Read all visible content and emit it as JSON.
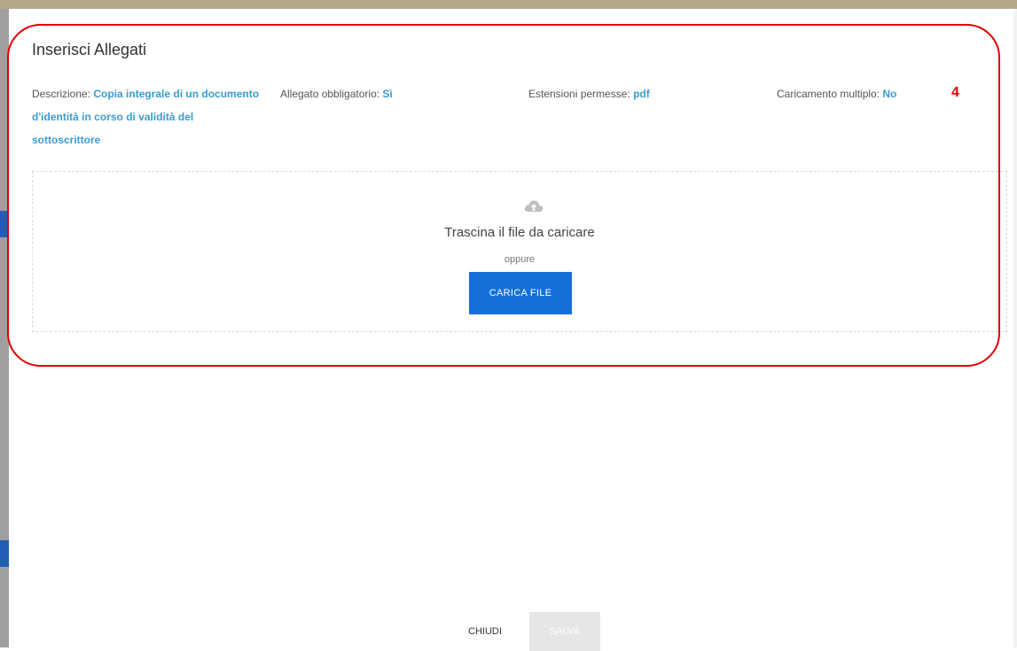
{
  "modal": {
    "title": "Inserisci Allegati",
    "descrizione_label": "Descrizione:",
    "descrizione_value": "Copia integrale di un documento d'identità in corso di validità del sottoscrittore",
    "obbligatorio_label": "Allegato obbligatorio:",
    "obbligatorio_value": "Sì",
    "estensioni_label": "Estensioni permesse:",
    "estensioni_value": "pdf",
    "multiplo_label": "Caricamento multiplo:",
    "multiplo_value": "No"
  },
  "dropzone": {
    "icon": "cloud-upload-icon",
    "drag_text": "Trascina il file da caricare",
    "or_text": "oppure",
    "upload_button": "CARICA FILE"
  },
  "footer": {
    "close_label": "CHIUDI",
    "save_label": "SALVA"
  },
  "annotation": {
    "number": "4"
  },
  "colors": {
    "accent": "#1770d9",
    "value_text": "#3a9bd1",
    "annotation": "#e00000"
  }
}
